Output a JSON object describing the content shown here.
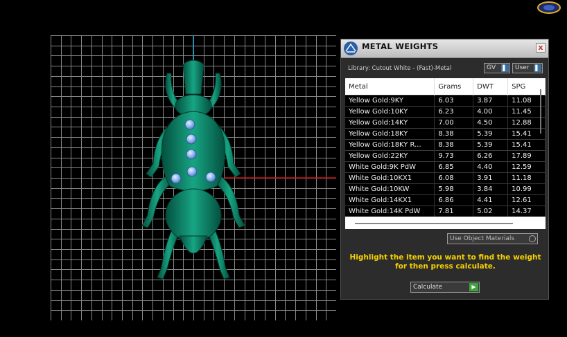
{
  "panel": {
    "title": "METAL WEIGHTS",
    "close_label": "x",
    "library_label": "Library: Cutout White - (Fast)-Metal",
    "gv_label": "GV",
    "user_label": "User",
    "use_object_materials_label": "Use Object Materials",
    "instruction_line1": "Highlight the item you want to find the weight",
    "instruction_line2": "for then press calculate.",
    "calculate_label": "Calculate"
  },
  "table": {
    "headers": [
      "Metal",
      "Grams",
      "DWT",
      "SPG"
    ],
    "rows": [
      [
        "Yellow Gold:9KY",
        "6.03",
        "3.87",
        "11.08"
      ],
      [
        "Yellow Gold:10KY",
        "6.23",
        "4.00",
        "11.45"
      ],
      [
        "Yellow Gold:14KY",
        "7.00",
        "4.50",
        "12.88"
      ],
      [
        "Yellow Gold:18KY",
        "8.38",
        "5.39",
        "15.41"
      ],
      [
        "Yellow Gold:18KY R...",
        "8.38",
        "5.39",
        "15.41"
      ],
      [
        "Yellow Gold:22KY",
        "9.73",
        "6.26",
        "17.89"
      ],
      [
        "White Gold:9K PdW",
        "6.85",
        "4.40",
        "12.59"
      ],
      [
        "White Gold:10KX1",
        "6.08",
        "3.91",
        "11.18"
      ],
      [
        "White Gold:10KW",
        "5.98",
        "3.84",
        "10.99"
      ],
      [
        "White Gold:14KX1",
        "6.86",
        "4.41",
        "12.61"
      ],
      [
        "White Gold:14K PdW",
        "7.81",
        "5.02",
        "14.37"
      ]
    ]
  },
  "colors": {
    "model": "#0d8a6e",
    "gem": "#8fb8f2",
    "grid": "#8a8a8a",
    "axis_y": "#1aa0c8",
    "axis_x": "#c81818",
    "instruction": "#f5d000"
  }
}
